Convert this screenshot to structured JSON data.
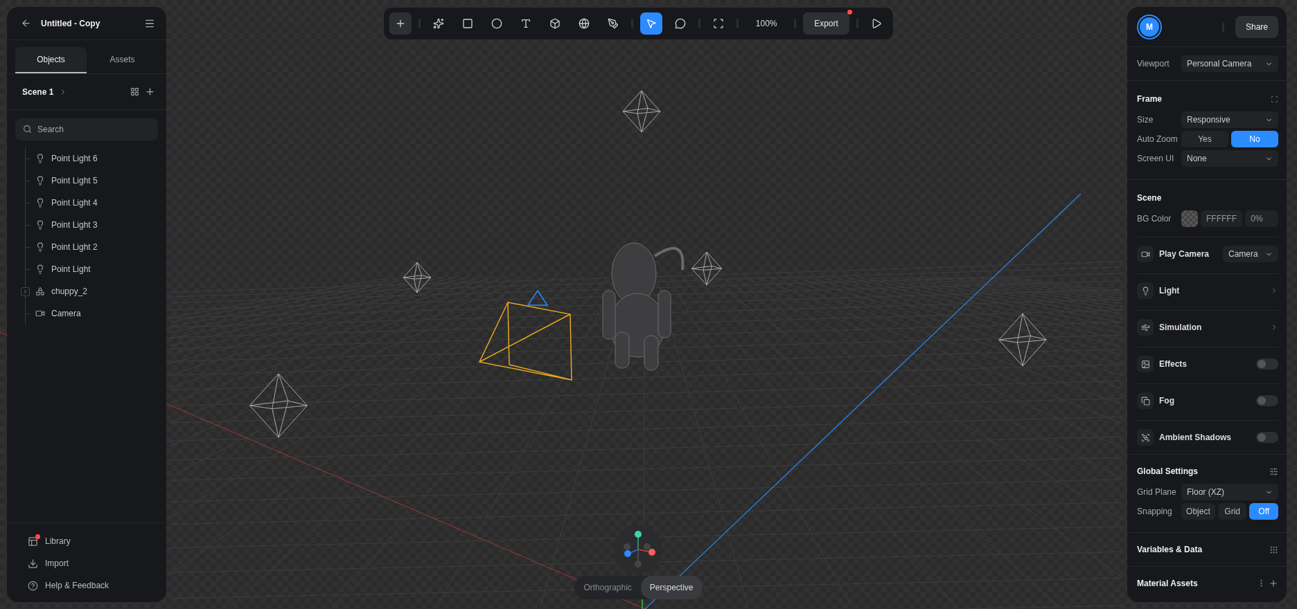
{
  "file": {
    "title": "Untitled - Copy"
  },
  "tabs": [
    {
      "label": "Objects",
      "selected": true
    },
    {
      "label": "Assets",
      "selected": false
    }
  ],
  "scene": {
    "title": "Scene 1"
  },
  "search": {
    "placeholder": "Search"
  },
  "tree": [
    {
      "label": "Point Light 6",
      "kind": "light"
    },
    {
      "label": "Point Light 5",
      "kind": "light"
    },
    {
      "label": "Point Light 4",
      "kind": "light"
    },
    {
      "label": "Point Light 3",
      "kind": "light"
    },
    {
      "label": "Point Light 2",
      "kind": "light"
    },
    {
      "label": "Point Light",
      "kind": "light"
    },
    {
      "label": "chuppy_2",
      "kind": "group",
      "expanded": false
    },
    {
      "label": "Camera",
      "kind": "camera"
    }
  ],
  "footer": [
    {
      "label": "Library",
      "kind": "library",
      "notification": true
    },
    {
      "label": "Import",
      "kind": "import",
      "notification": false
    },
    {
      "label": "Help & Feedback",
      "kind": "help",
      "notification": false
    }
  ],
  "toolbar": {
    "tools": [
      {
        "kind": "add",
        "selected": false
      },
      {
        "kind": "sep"
      },
      {
        "kind": "ai",
        "selected": false
      },
      {
        "kind": "rect",
        "selected": false
      },
      {
        "kind": "ellipse",
        "selected": false
      },
      {
        "kind": "text",
        "selected": false
      },
      {
        "kind": "cube",
        "selected": false
      },
      {
        "kind": "sphere",
        "selected": false
      },
      {
        "kind": "pen",
        "selected": false
      },
      {
        "kind": "sep"
      },
      {
        "kind": "select",
        "selected": true
      },
      {
        "kind": "comment",
        "selected": false
      },
      {
        "kind": "sep"
      },
      {
        "kind": "frame",
        "selected": false
      },
      {
        "kind": "sep"
      }
    ],
    "zoom": "100%",
    "export": {
      "label": "Export",
      "notification": true
    }
  },
  "projection": [
    {
      "label": "Orthographic",
      "selected": false
    },
    {
      "label": "Perspective",
      "selected": true
    }
  ],
  "inspector": {
    "avatar": "M",
    "share": "Share",
    "viewport": {
      "label": "Viewport",
      "value": "Personal Camera"
    },
    "frame": {
      "title": "Frame",
      "size": {
        "label": "Size",
        "value": "Responsive"
      },
      "auto_zoom": {
        "label": "Auto Zoom",
        "options": [
          {
            "label": "Yes",
            "selected": false
          },
          {
            "label": "No",
            "selected": true
          }
        ]
      },
      "screen_ui": {
        "label": "Screen UI",
        "value": "None"
      }
    },
    "scene": {
      "title": "Scene",
      "bg_color": {
        "label": "BG Color",
        "hex": "FFFFFF",
        "opacity": "0%"
      },
      "rows": [
        {
          "label": "Play Camera",
          "kind": "select",
          "value": "Camera"
        },
        {
          "label": "Light",
          "kind": "link"
        },
        {
          "label": "Simulation",
          "kind": "link"
        },
        {
          "label": "Effects",
          "kind": "toggle",
          "on": false
        },
        {
          "label": "Fog",
          "kind": "toggle",
          "on": false
        },
        {
          "label": "Ambient Shadows",
          "kind": "toggle",
          "on": false
        }
      ]
    },
    "global": {
      "title": "Global Settings",
      "grid_plane": {
        "label": "Grid Plane",
        "value": "Floor (XZ)"
      },
      "snapping": {
        "label": "Snapping",
        "options": [
          {
            "label": "Object",
            "selected": false
          },
          {
            "label": "Grid",
            "selected": false
          },
          {
            "label": "Off",
            "selected": true
          }
        ]
      }
    },
    "sections": [
      {
        "title": "Variables & Data",
        "kind": "variables"
      },
      {
        "title": "Material Assets",
        "kind": "materials"
      }
    ]
  }
}
